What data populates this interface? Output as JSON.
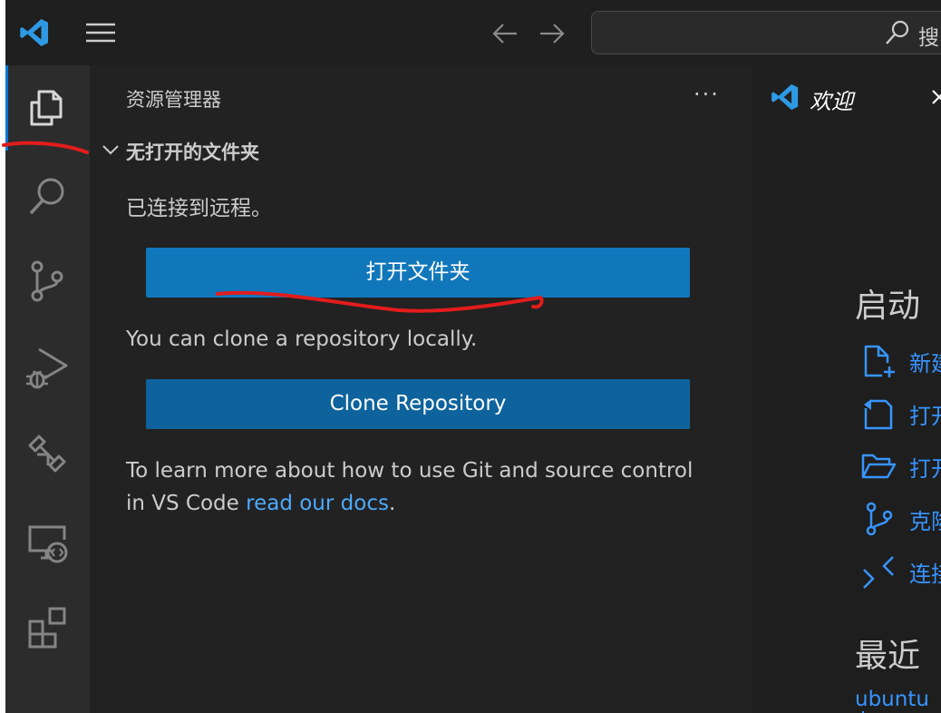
{
  "titlebar": {
    "search_text": "搜"
  },
  "sidebar": {
    "title": "资源管理器",
    "more": "···",
    "section_title": "无打开的文件夹",
    "connected_text": "已连接到远程。",
    "open_folder_label": "打开文件夹",
    "clone_hint": "You can clone a repository locally.",
    "clone_label": "Clone Repository",
    "learn_line1": "To learn more about how to use Git and source control",
    "learn_line2_prefix": "in VS Code ",
    "learn_link": "read our docs",
    "learn_suffix": "."
  },
  "editor": {
    "tab_label": "欢迎",
    "startup_title": "启动",
    "startup_items": [
      {
        "label": "新建",
        "icon": "new-file-icon"
      },
      {
        "label": "打开",
        "icon": "open-file-icon"
      },
      {
        "label": "打开",
        "icon": "open-folder-icon"
      },
      {
        "label": "克隆",
        "icon": "source-control-icon"
      },
      {
        "label": "连接",
        "icon": "remote-connect-icon"
      }
    ],
    "recent_title": "最近",
    "recent_items": [
      {
        "label": "ubuntu"
      }
    ]
  },
  "colors": {
    "accent_blue": "#0e78c2",
    "button_primary": "#1177bb",
    "button_secondary": "#0e639c",
    "link": "#4daafc",
    "vscode_logo": "#2d9ae3",
    "annotation_red": "#e31c1c"
  }
}
